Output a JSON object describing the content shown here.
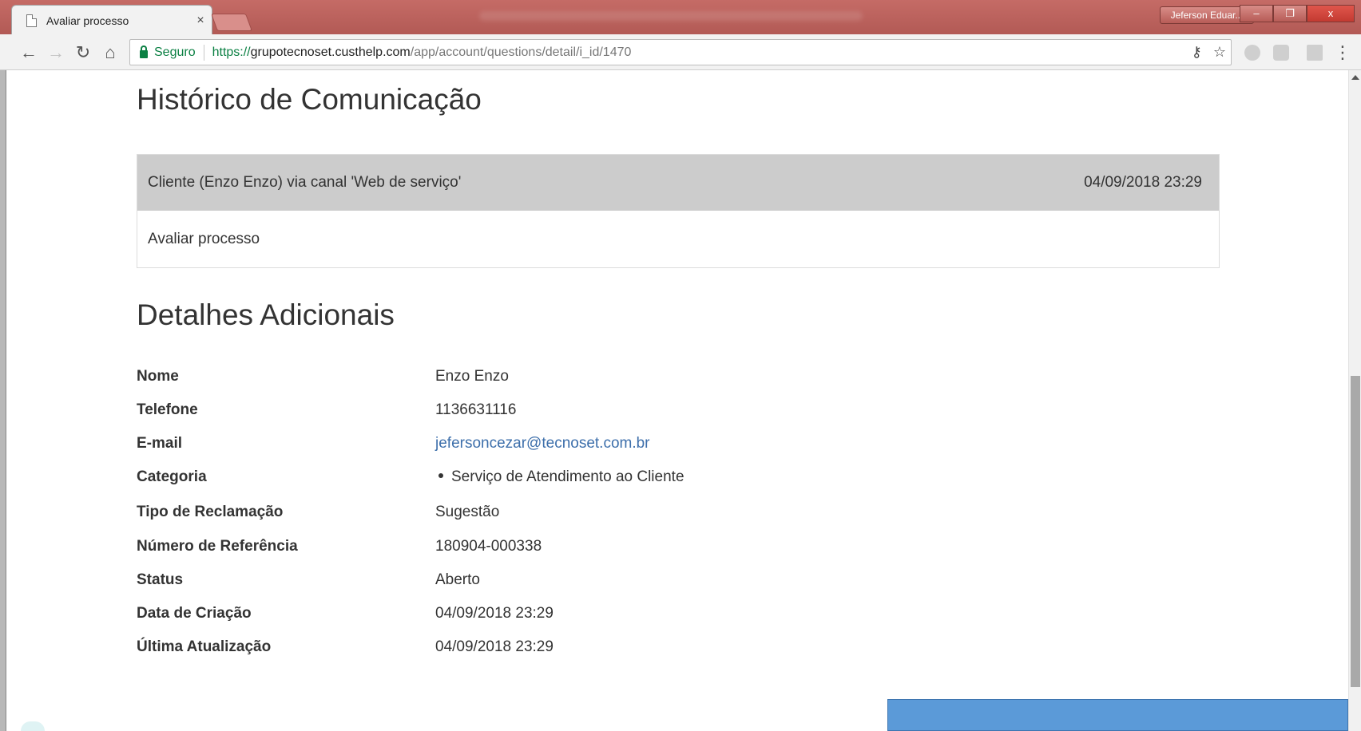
{
  "browser": {
    "tab_title": "Avaliar processo",
    "tab_close": "×",
    "profile_name": "Jeferson Eduar...",
    "secure_label": "Seguro",
    "url_scheme": "https://",
    "url_host": "grupotecnoset.custhelp.com",
    "url_path": "/app/account/questions/detail/i_id/1470",
    "win_minimize": "‒",
    "win_maximize": "❐",
    "win_close": "x"
  },
  "history": {
    "title": "Histórico de Comunicação",
    "header_text": "Cliente (Enzo Enzo) via canal 'Web de serviço'",
    "header_date": "04/09/2018 23:29",
    "body_text": "Avaliar processo"
  },
  "details": {
    "title": "Detalhes Adicionais",
    "rows": [
      {
        "label": "Nome",
        "value": "Enzo Enzo"
      },
      {
        "label": "Telefone",
        "value": "1136631116"
      },
      {
        "label": "E-mail",
        "value": "jefersoncezar@tecnoset.com.br"
      },
      {
        "label": "Categoria",
        "value": "Serviço de Atendimento ao Cliente"
      },
      {
        "label": "Tipo de Reclamação",
        "value": "Sugestão"
      },
      {
        "label": "Número de Referência",
        "value": "180904-000338"
      },
      {
        "label": "Status",
        "value": "Aberto"
      },
      {
        "label": "Data de Criação",
        "value": "04/09/2018 23:29"
      },
      {
        "label": "Última Atualização",
        "value": "04/09/2018 23:29"
      }
    ]
  },
  "colors": {
    "secure_green": "#0b8043",
    "link_blue": "#3d6fab",
    "thread_header_bg": "#cccccc",
    "chat_panel_blue": "#5b9ad8"
  }
}
